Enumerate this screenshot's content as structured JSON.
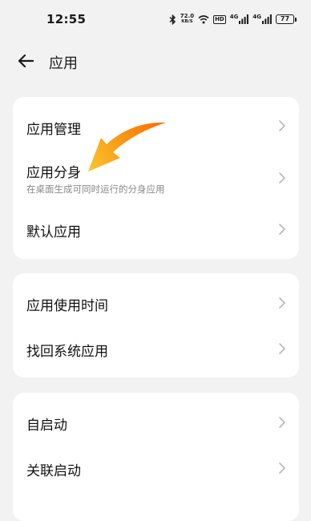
{
  "status_bar": {
    "time": "12:55",
    "net_speed_value": "72.0",
    "net_speed_unit": "KB/S",
    "hd_badge": "HD",
    "sim1_label": "4G",
    "sim2_label": "4G",
    "battery": "77"
  },
  "header": {
    "title": "应用"
  },
  "groups": [
    {
      "items": [
        {
          "title": "应用管理",
          "subtitle": ""
        },
        {
          "title": "应用分身",
          "subtitle": "在桌面生成可同时运行的分身应用"
        },
        {
          "title": "默认应用",
          "subtitle": ""
        }
      ]
    },
    {
      "items": [
        {
          "title": "应用使用时间"
        },
        {
          "title": "找回系统应用"
        }
      ]
    },
    {
      "items": [
        {
          "title": "自启动"
        },
        {
          "title": "关联启动"
        }
      ]
    }
  ],
  "annotation": {
    "icon": "orange-arrow-icon",
    "color": "#f39c12"
  }
}
